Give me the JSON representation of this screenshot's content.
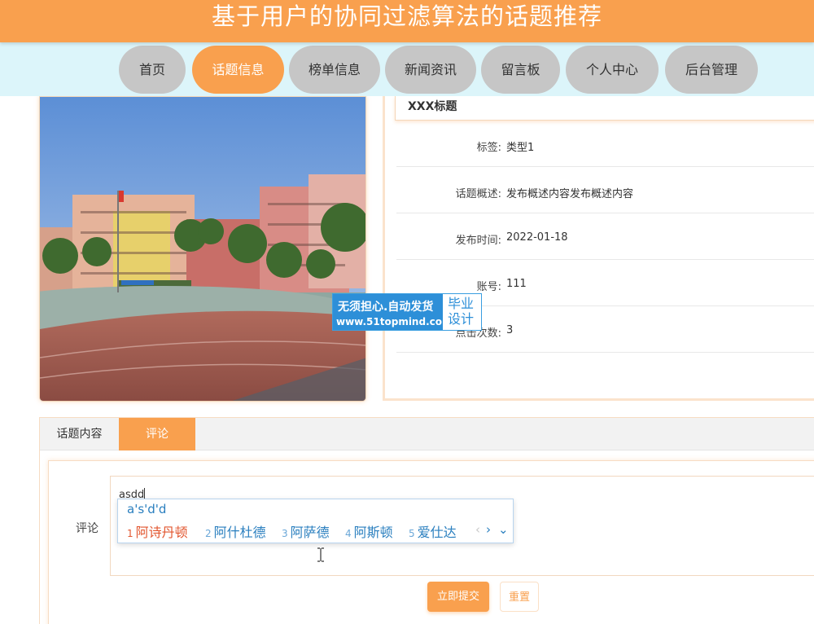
{
  "header": {
    "title": "基于用户的协同过滤算法的话题推荐"
  },
  "nav": {
    "items": [
      {
        "label": "首页"
      },
      {
        "label": "话题信息",
        "active": true
      },
      {
        "label": "榜单信息"
      },
      {
        "label": "新闻资讯"
      },
      {
        "label": "留言板"
      },
      {
        "label": "个人中心"
      },
      {
        "label": "后台管理"
      }
    ]
  },
  "detail": {
    "title": "XXX标题",
    "rows": [
      {
        "label": "标签:",
        "value": "类型1"
      },
      {
        "label": "话题概述:",
        "value": "发布概述内容发布概述内容"
      },
      {
        "label": "发布时间:",
        "value": "2022-01-18"
      },
      {
        "label": "账号:",
        "value": "111"
      },
      {
        "label": "点击次数:",
        "value": "3"
      }
    ]
  },
  "watermark": {
    "line1": "无须担心.自动发货",
    "line2": "www.51topmind.com",
    "side_line1": "毕业",
    "side_line2": "设计"
  },
  "tabs": [
    {
      "label": "话题内容"
    },
    {
      "label": "评论",
      "active": true
    }
  ],
  "comment": {
    "label": "评论",
    "value": "asdd"
  },
  "ime": {
    "input": "a's'd'd",
    "candidates": [
      {
        "num": "1",
        "text": "阿诗丹顿"
      },
      {
        "num": "2",
        "text": "阿什杜德"
      },
      {
        "num": "3",
        "text": "阿萨德"
      },
      {
        "num": "4",
        "text": "阿斯顿"
      },
      {
        "num": "5",
        "text": "爱仕达"
      }
    ],
    "prev": "‹",
    "next": "›",
    "expand": "⌄"
  },
  "buttons": {
    "submit": "立即提交",
    "reset": "重置"
  },
  "colors": {
    "accent": "#f9a04e",
    "nav_bg": "#dcf5fa",
    "nav_inactive": "#c6c6c6",
    "ime_text": "#2a7fbf",
    "ime_selected": "#e2562f"
  }
}
